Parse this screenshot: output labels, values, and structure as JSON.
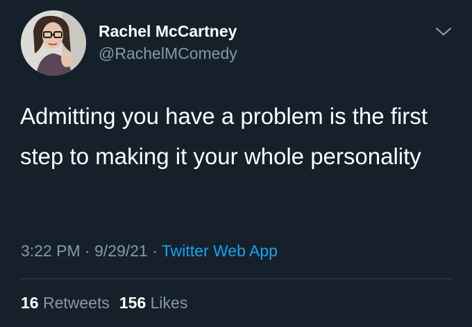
{
  "user": {
    "display_name": "Rachel McCartney",
    "handle": "@RachelMComedy"
  },
  "tweet": {
    "text": "Admitting you have a problem is the first step to making it your whole personality",
    "time": "3:22 PM",
    "separator": " · ",
    "date": "9/29/21",
    "source": "Twitter Web App"
  },
  "stats": {
    "retweets_count": "16",
    "retweets_label": "Retweets",
    "likes_count": "156",
    "likes_label": "Likes"
  },
  "icons": {
    "menu": "chevron-down-icon",
    "avatar": "profile-photo"
  },
  "colors": {
    "background": "#15202b",
    "text": "#ffffff",
    "secondary": "#8899a6",
    "link": "#1da1f2",
    "divider": "#38444d"
  }
}
